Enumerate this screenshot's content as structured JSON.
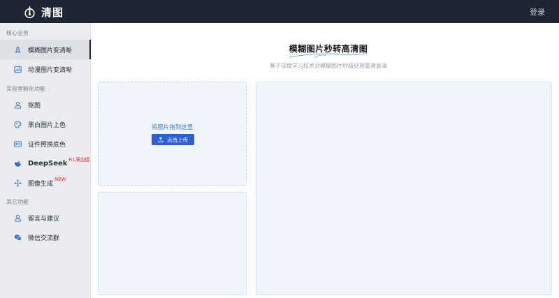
{
  "header": {
    "app_name": "清图",
    "login_label": "登录"
  },
  "sidebar": {
    "sections": [
      {
        "label": "核心业务",
        "items": [
          {
            "label": "模糊图片变清晰",
            "icon": "rocket-icon",
            "active": true
          },
          {
            "label": "动漫图片变清晰",
            "icon": "image-icon"
          }
        ]
      },
      {
        "label": "实验室孵化功能",
        "items": [
          {
            "label": "抠图",
            "icon": "person-icon"
          },
          {
            "label": "黑白图片上色",
            "icon": "palette-icon"
          },
          {
            "label": "证件照换底色",
            "icon": "id-card-icon"
          },
          {
            "label": "DeepSeek",
            "icon": "deepseek-icon",
            "tag": "R1满血版"
          },
          {
            "label": "图像生成",
            "icon": "move-icon",
            "tag": "NEW"
          }
        ]
      },
      {
        "label": "其它功能",
        "items": [
          {
            "label": "留言与建议",
            "icon": "person-icon"
          },
          {
            "label": "微信交流群",
            "icon": "wechat-icon"
          }
        ]
      }
    ]
  },
  "main": {
    "title": "模糊图片秒转高清图",
    "subtitle": "基于深度学习技术对模糊图片秒级处理重建高清",
    "upload": {
      "hint": "将图片拖到这里",
      "button_label": "点击上传"
    }
  },
  "colors": {
    "topbar": "#1f2532",
    "accent": "#2c5fd6",
    "panel_bg": "#f0f5fc",
    "tag_red": "#ef3e3e"
  }
}
